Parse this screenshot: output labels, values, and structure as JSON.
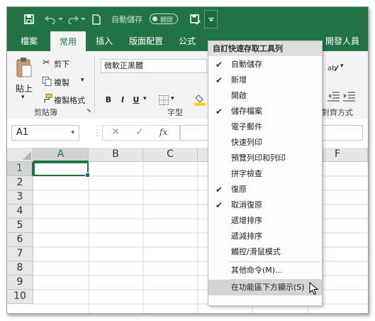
{
  "title_bar": {
    "autosave_label": "自動儲存",
    "autosave_state": "關閉"
  },
  "tabs": [
    {
      "label": "檔案"
    },
    {
      "label": "常用"
    },
    {
      "label": "插入"
    },
    {
      "label": "版面配置"
    },
    {
      "label": "公式"
    },
    {
      "label": "開發人員"
    }
  ],
  "ribbon": {
    "clipboard": {
      "paste": "貼上",
      "cut": "剪下",
      "copy": "複製",
      "format_painter": "複製格式",
      "group_label": "剪貼簿"
    },
    "font": {
      "font_name": "微軟正黑體",
      "bold": "B",
      "italic": "I",
      "underline": "U",
      "group_label": "字型"
    },
    "alignment": {
      "group_label": "對齊方式"
    }
  },
  "formula_bar": {
    "name_box": "A1",
    "fx_label": "fx"
  },
  "grid": {
    "columns": [
      "A",
      "B",
      "C",
      "F"
    ],
    "rows": [
      "1",
      "2",
      "3",
      "4",
      "5",
      "6",
      "7",
      "8",
      "9",
      "10"
    ],
    "selected_cell": "A1"
  },
  "qat_menu": {
    "header": "自訂快速存取工具列",
    "items": [
      {
        "label": "自動儲存",
        "checked": true
      },
      {
        "label": "新增",
        "checked": true
      },
      {
        "label": "開啟",
        "checked": false
      },
      {
        "label": "儲存檔案",
        "checked": true
      },
      {
        "label": "電子郵件",
        "checked": false
      },
      {
        "label": "快速列印",
        "checked": false
      },
      {
        "label": "預覽列印和列印",
        "checked": false
      },
      {
        "label": "拼字檢查",
        "checked": false
      },
      {
        "label": "復原",
        "checked": true
      },
      {
        "label": "取消復原",
        "checked": true
      },
      {
        "label": "遞增排序",
        "checked": false
      },
      {
        "label": "遞減排序",
        "checked": false
      },
      {
        "label": "觸控/滑鼠模式",
        "checked": false
      }
    ],
    "more_commands": "其他命令(M)...",
    "show_below_ribbon": "在功能區下方顯示(S)",
    "check_glyph": "✔"
  }
}
